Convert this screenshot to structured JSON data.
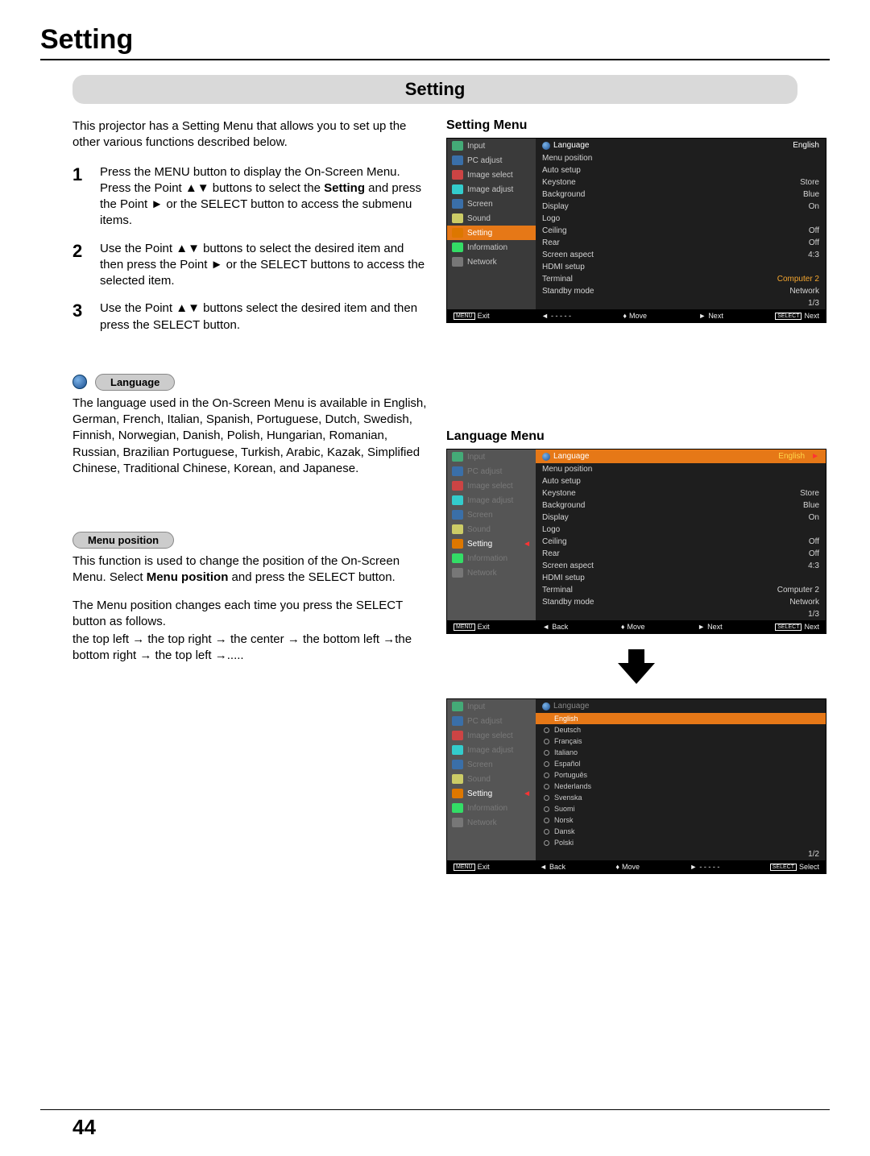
{
  "page": {
    "title": "Setting",
    "section_bar": "Setting",
    "intro": "This projector has a Setting Menu that allows you to set up the other various functions described below.",
    "page_number": "44"
  },
  "steps": [
    {
      "num": "1",
      "text_pre": "Press the MENU button to display the On-Screen Menu. Press the Point ▲▼ buttons to select the ",
      "bold": "Setting",
      "text_post": " and press the Point ► or the SELECT button to access the submenu items."
    },
    {
      "num": "2",
      "text": "Use the Point ▲▼ buttons to select the desired item and then press the Point ► or the SELECT buttons to access the selected item."
    },
    {
      "num": "3",
      "text": "Use the Point ▲▼ buttons select the desired item and then press the SELECT button."
    }
  ],
  "language_section": {
    "pill": "Language",
    "text": "The language used in the On-Screen Menu is available in English, German, French, Italian, Spanish, Portuguese, Dutch, Swedish, Finnish, Norwegian, Danish, Polish, Hungarian, Romanian, Russian, Brazilian Portuguese, Turkish, Arabic, Kazak, Simplified Chinese, Traditional Chinese, Korean, and Japanese."
  },
  "menu_position_section": {
    "pill": "Menu position",
    "p1_pre": "This function is used to change the position of the On-Screen Menu. Select ",
    "p1_bold": "Menu position",
    "p1_post": " and press the SELECT button.",
    "p2": "The Menu position changes each time you press the SELECT button as follows.",
    "p3": "the top left  → the top right  → the center  → the bottom left →the bottom right  → the top left  →....."
  },
  "right_titles": {
    "setting": "Setting Menu",
    "language": "Language Menu"
  },
  "osd_left_items": [
    {
      "label": "Input",
      "ico": "g"
    },
    {
      "label": "PC adjust",
      "ico": "b"
    },
    {
      "label": "Image select",
      "ico": "r"
    },
    {
      "label": "Image adjust",
      "ico": "c"
    },
    {
      "label": "Screen",
      "ico": "b"
    },
    {
      "label": "Sound",
      "ico": "y"
    },
    {
      "label": "Setting",
      "ico": "o"
    },
    {
      "label": "Information",
      "ico": "i"
    },
    {
      "label": "Network",
      "ico": "n"
    }
  ],
  "osd1_hdr": "Language",
  "osd1_hdr_val": "English",
  "osd1_rows": [
    {
      "label": "Menu position",
      "val": ""
    },
    {
      "label": "Auto setup",
      "val": ""
    },
    {
      "label": "Keystone",
      "val": "Store"
    },
    {
      "label": "Background",
      "val": "Blue"
    },
    {
      "label": "Display",
      "val": "On"
    },
    {
      "label": "Logo",
      "val": ""
    },
    {
      "label": "Ceiling",
      "val": "Off"
    },
    {
      "label": "Rear",
      "val": "Off"
    },
    {
      "label": "Screen aspect",
      "val": "4:3"
    },
    {
      "label": "HDMI setup",
      "val": ""
    },
    {
      "label": "Terminal",
      "val": "Computer 2",
      "yl": true
    },
    {
      "label": "Standby mode",
      "val": "Network"
    }
  ],
  "osd1_page": "1/3",
  "osd_footer1": {
    "a": "Exit",
    "b": "- - - - -",
    "c": "Move",
    "d": "Next",
    "e": "Next",
    "box_a": "MENU",
    "box_e": "SELECT"
  },
  "osd_footer2": {
    "a": "Exit",
    "b": "Back",
    "c": "Move",
    "d": "Next",
    "e": "Next",
    "box_a": "MENU",
    "box_e": "SELECT"
  },
  "osd2_hdr": "Language",
  "osd2_hdr_val": "English",
  "osd2_rows": [
    {
      "label": "Menu position",
      "val": ""
    },
    {
      "label": "Auto setup",
      "val": ""
    },
    {
      "label": "Keystone",
      "val": "Store"
    },
    {
      "label": "Background",
      "val": "Blue"
    },
    {
      "label": "Display",
      "val": "On"
    },
    {
      "label": "Logo",
      "val": ""
    },
    {
      "label": "Ceiling",
      "val": "Off"
    },
    {
      "label": "Rear",
      "val": "Off"
    },
    {
      "label": "Screen aspect",
      "val": "4:3"
    },
    {
      "label": "HDMI setup",
      "val": ""
    },
    {
      "label": "Terminal",
      "val": "Computer 2"
    },
    {
      "label": "Standby mode",
      "val": "Network"
    }
  ],
  "osd2_page": "1/3",
  "osd3_hdr": "Language",
  "osd3_langs": [
    "English",
    "Deutsch",
    "Français",
    "Italiano",
    "Español",
    "Português",
    "Nederlands",
    "Svenska",
    "Suomi",
    "Norsk",
    "Dansk",
    "Polski"
  ],
  "osd3_page": "1/2",
  "osd_footer3": {
    "a": "Exit",
    "b": "Back",
    "c": "Move",
    "d": "- - - - -",
    "e": "Select",
    "box_a": "MENU",
    "box_e": "SELECT"
  }
}
